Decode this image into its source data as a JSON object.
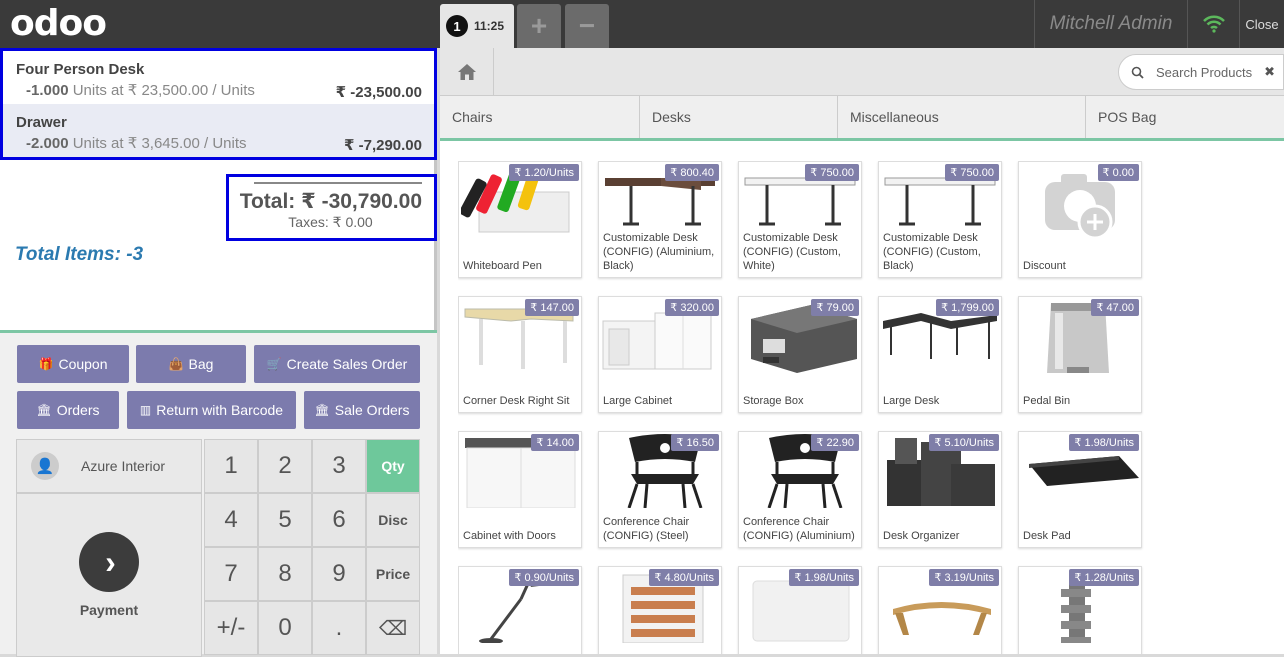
{
  "topbar": {
    "logo": "odoo",
    "order_number": "1",
    "order_time": "11:25",
    "add_order": "+",
    "remove_order": "−",
    "cashier": "Mitchell Admin",
    "close": "Close"
  },
  "orderlines": [
    {
      "name": "Four Person Desk",
      "qty": "-1.000",
      "unit_info": "Units at ₹ 23,500.00 / Units",
      "price": "₹ -23,500.00"
    },
    {
      "name": "Drawer",
      "qty": "-2.000",
      "unit_info": "Units at ₹ 3,645.00 / Units",
      "price": "₹ -7,290.00"
    }
  ],
  "summary": {
    "total": "Total: ₹ -30,790.00",
    "taxes": "Taxes: ₹ 0.00",
    "total_items": "Total Items: -3"
  },
  "actions": {
    "coupon": "Coupon",
    "bag": "Bag",
    "create_sales_order": "Create Sales Order",
    "orders": "Orders",
    "return_barcode": "Return with Barcode",
    "sale_orders": "Sale Orders"
  },
  "numpad": {
    "customer": "Azure Interior",
    "payment": "Payment",
    "keys": [
      "1",
      "2",
      "3",
      "4",
      "5",
      "6",
      "7",
      "8",
      "9",
      "+/-",
      "0",
      "."
    ],
    "qty": "Qty",
    "disc": "Disc",
    "price": "Price",
    "backspace": "⌫"
  },
  "search": {
    "placeholder": "Search Products"
  },
  "categories": [
    "Chairs",
    "Desks",
    "Miscellaneous",
    "POS Bag"
  ],
  "products": [
    {
      "name": "Whiteboard Pen",
      "price": "₹ 1.20/Units",
      "icon": "whiteboard-pen"
    },
    {
      "name": "Customizable Desk (CONFIG) (Aluminium, Black)",
      "price": "₹ 800.40",
      "icon": "desk-dark"
    },
    {
      "name": "Customizable Desk (CONFIG) (Custom, White)",
      "price": "₹ 750.00",
      "icon": "desk-white"
    },
    {
      "name": "Customizable Desk (CONFIG) (Custom, Black)",
      "price": "₹ 750.00",
      "icon": "desk-white"
    },
    {
      "name": "Discount",
      "price": "₹ 0.00",
      "icon": "camera-placeholder"
    },
    {
      "name": "Corner Desk Right Sit",
      "price": "₹ 147.00",
      "icon": "corner-desk"
    },
    {
      "name": "Large Cabinet",
      "price": "₹ 320.00",
      "icon": "cabinet"
    },
    {
      "name": "Storage Box",
      "price": "₹ 79.00",
      "icon": "storage-box"
    },
    {
      "name": "Large Desk",
      "price": "₹ 1,799.00",
      "icon": "large-desk"
    },
    {
      "name": "Pedal Bin",
      "price": "₹ 47.00",
      "icon": "pedal-bin"
    },
    {
      "name": "Cabinet with Doors",
      "price": "₹ 14.00",
      "icon": "cabinet-doors"
    },
    {
      "name": "Conference Chair (CONFIG) (Steel)",
      "price": "₹ 16.50",
      "icon": "chair"
    },
    {
      "name": "Conference Chair (CONFIG) (Aluminium)",
      "price": "₹ 22.90",
      "icon": "chair"
    },
    {
      "name": "Desk Organizer",
      "price": "₹ 5.10/Units",
      "icon": "desk-organizer"
    },
    {
      "name": "Desk Pad",
      "price": "₹ 1.98/Units",
      "icon": "desk-pad"
    },
    {
      "name": "",
      "price": "₹ 0.90/Units",
      "icon": "lamp"
    },
    {
      "name": "",
      "price": "₹ 4.80/Units",
      "icon": "letter-tray"
    },
    {
      "name": "",
      "price": "₹ 1.98/Units",
      "icon": "whiteboard"
    },
    {
      "name": "",
      "price": "₹ 3.19/Units",
      "icon": "monitor-stand"
    },
    {
      "name": "",
      "price": "₹ 1.28/Units",
      "icon": "file-rack"
    }
  ]
}
